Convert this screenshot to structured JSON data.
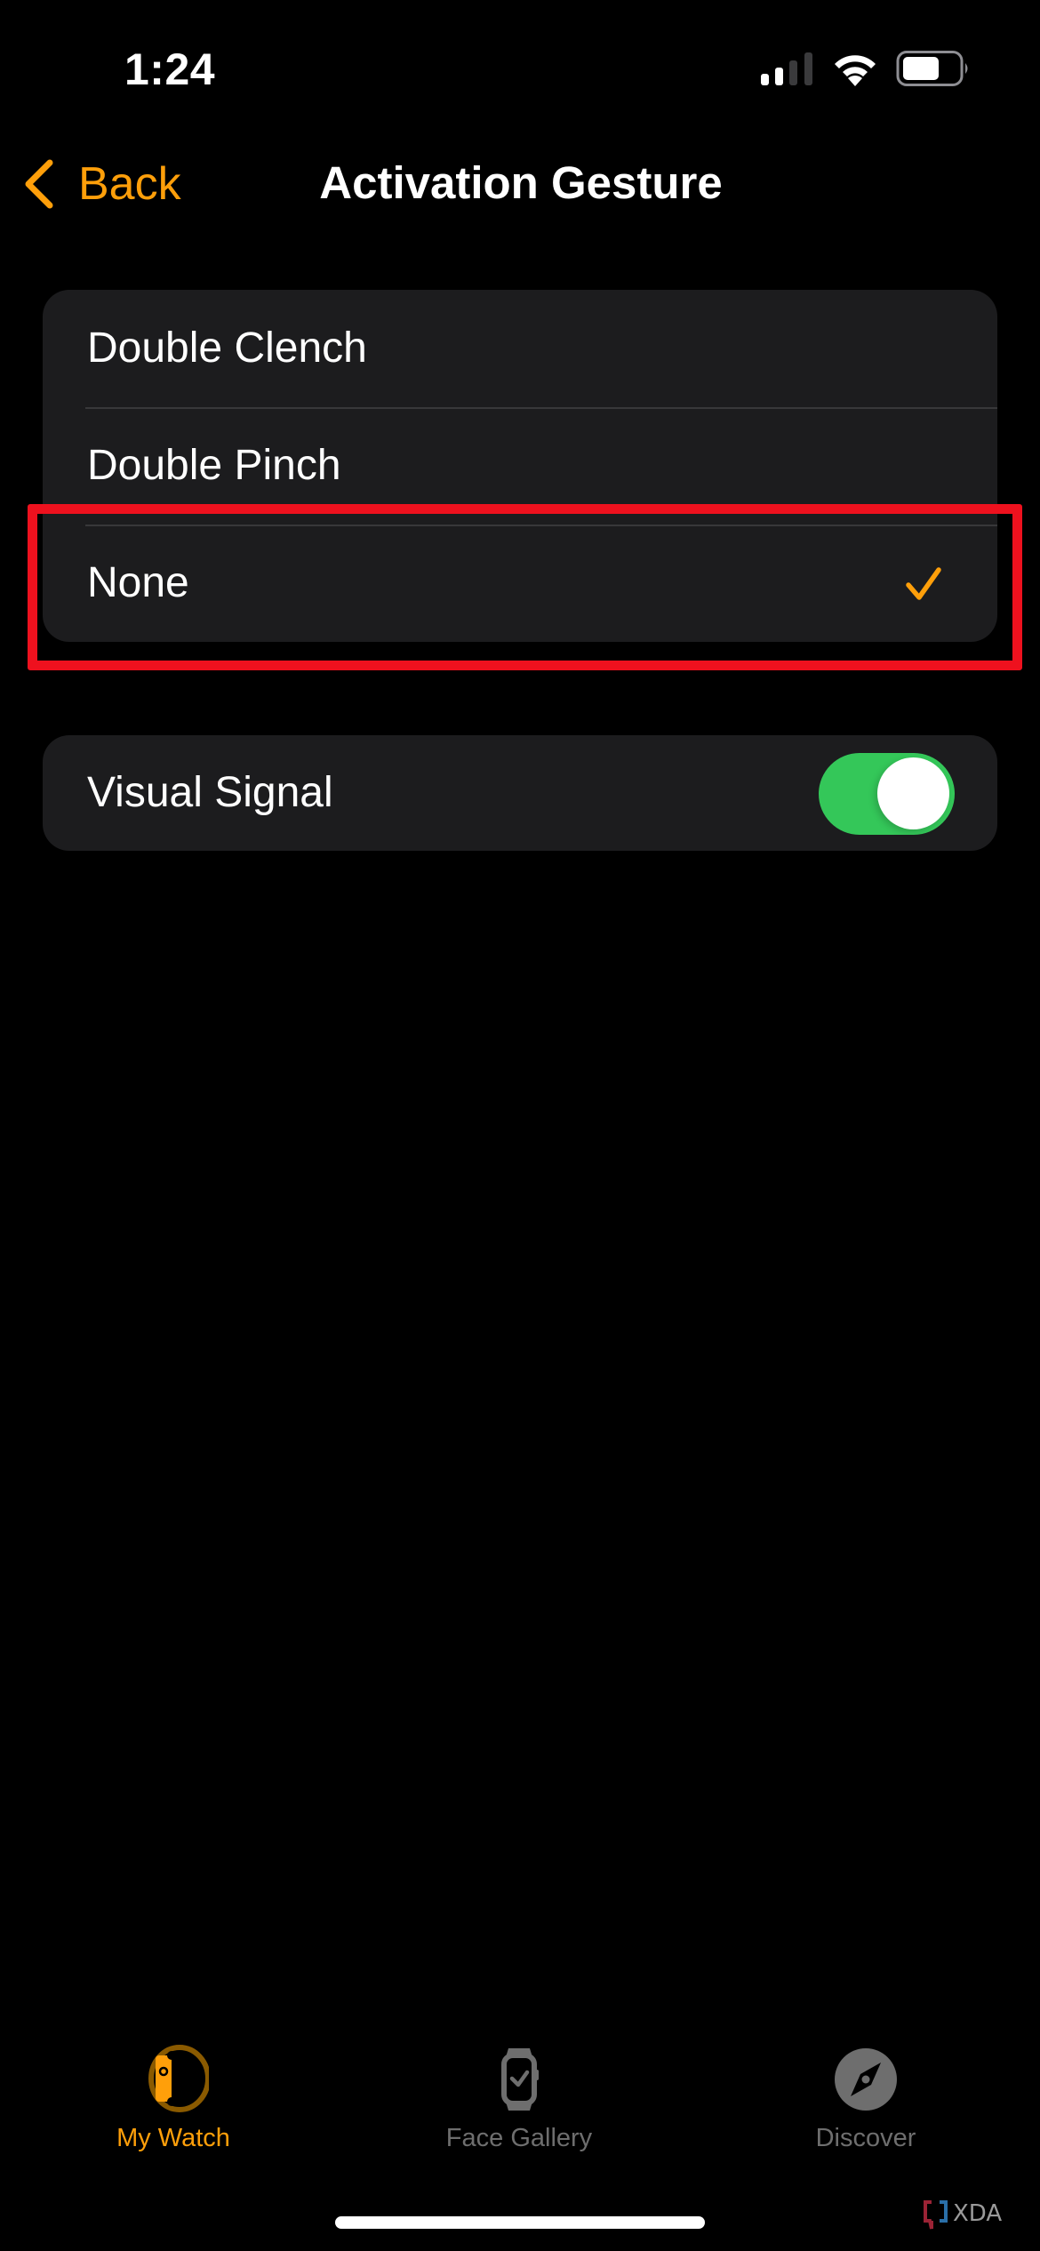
{
  "status_bar": {
    "time": "1:24",
    "signal_bars_active": 2,
    "signal_bars_total": 4,
    "battery_level": 0.55,
    "icons": [
      "cellular-signal-icon",
      "wifi-icon",
      "battery-icon"
    ]
  },
  "nav": {
    "back_label": "Back",
    "title": "Activation Gesture"
  },
  "gesture_options": {
    "items": [
      {
        "label": "Double Clench",
        "selected": false
      },
      {
        "label": "Double Pinch",
        "selected": false
      },
      {
        "label": "None",
        "selected": true
      }
    ]
  },
  "visual_signal": {
    "label": "Visual Signal",
    "enabled": true
  },
  "tab_bar": {
    "items": [
      {
        "label": "My Watch",
        "icon": "watch-side-icon",
        "active": true
      },
      {
        "label": "Face Gallery",
        "icon": "watch-face-icon",
        "active": false
      },
      {
        "label": "Discover",
        "icon": "compass-icon",
        "active": false
      }
    ]
  },
  "watermark": {
    "text": "XDA"
  },
  "colors": {
    "accent": "#FF9F0A",
    "toggle_on": "#34C759",
    "card_bg": "#1C1C1E",
    "highlight": "#EE111E",
    "inactive_tab": "#6E6E6E"
  }
}
